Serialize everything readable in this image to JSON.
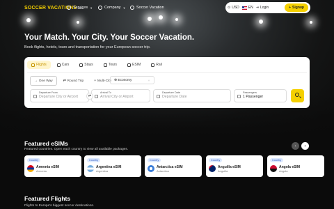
{
  "brand": {
    "logo": "SOCCER VACATIONS",
    "logo_suffix": ".com",
    "accent": "#f5d000"
  },
  "nav": {
    "services": "Services",
    "company": "Company",
    "soccer_vacation": "Soccer Vacation",
    "currency": "USD",
    "language": "EN",
    "login": "Login",
    "signup": "Signup"
  },
  "hero": {
    "title": "Your Match. Your City. Your Soccer Vacation.",
    "subtitle": "Book flights, hotels, tours and transportation for your European soccer trip."
  },
  "search": {
    "tabs": [
      {
        "label": "Flights",
        "icon": "plane-icon"
      },
      {
        "label": "Cars",
        "icon": "car-icon"
      },
      {
        "label": "Stays",
        "icon": "bed-icon"
      },
      {
        "label": "Tours",
        "icon": "compass-icon"
      },
      {
        "label": "ESIM",
        "icon": "sim-icon"
      },
      {
        "label": "Rail",
        "icon": "train-icon"
      }
    ],
    "trip_types": [
      "One Way",
      "Round Trip",
      "Multi-City"
    ],
    "cabin": "Economy",
    "from_label": "Departure From",
    "from_placeholder": "Departure City or Airport",
    "to_label": "Arrival To",
    "to_placeholder": "Arrival City or Airport",
    "date_label": "Departure Date",
    "date_placeholder": "Departure Date",
    "passengers_label": "Passengers",
    "passengers_value": "1 Passenger"
  },
  "esims": {
    "title": "Featured eSIMs",
    "subtitle": "Featured countries. Open each country to view all available packages.",
    "badge": "Country",
    "items": [
      {
        "name": "Armenia eSIM",
        "country": "Armenia"
      },
      {
        "name": "Argentina eSIM",
        "country": "Argentina"
      },
      {
        "name": "Antarctica eSIM",
        "country": "Antarctica"
      },
      {
        "name": "Anguilla eSIM",
        "country": "Anguilla"
      },
      {
        "name": "Angola eSIM",
        "country": "Angola"
      }
    ]
  },
  "flights": {
    "title": "Featured Flights",
    "subtitle": "Flights to Europe's biggest soccer destinations."
  }
}
